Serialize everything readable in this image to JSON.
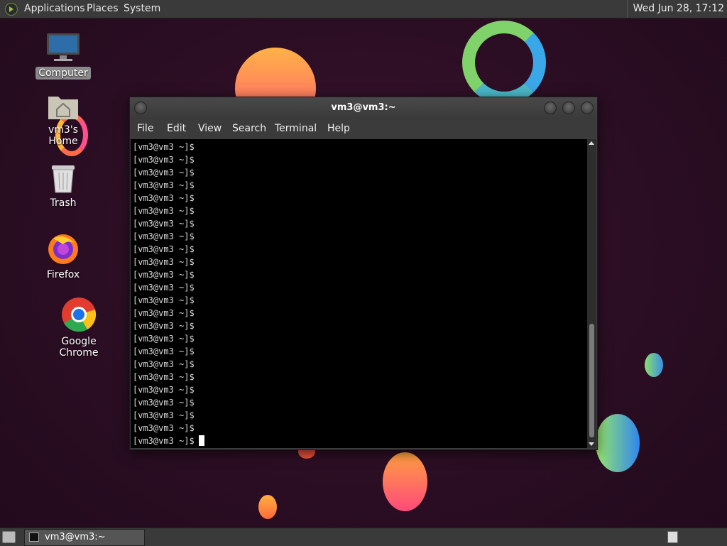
{
  "top_panel": {
    "menus": [
      "Applications",
      "Places",
      "System"
    ],
    "clock": "Wed Jun 28, 17:12"
  },
  "desktop_icons": [
    {
      "label": "Computer",
      "icon": "computer-icon"
    },
    {
      "label": "vm3's Home",
      "icon": "home-folder-icon"
    },
    {
      "label": "Trash",
      "icon": "trash-icon"
    },
    {
      "label": "Firefox",
      "icon": "firefox-icon"
    },
    {
      "label": "Google Chrome",
      "icon": "chrome-icon"
    }
  ],
  "terminal": {
    "title": "vm3@vm3:~",
    "menu": [
      "File",
      "Edit",
      "View",
      "Search",
      "Terminal",
      "Help"
    ],
    "prompt": "[vm3@vm3 ~]$",
    "line_count": 24
  },
  "taskbar": {
    "items": [
      {
        "label": "vm3@vm3:~"
      }
    ]
  },
  "colors": {
    "panel": "#3a3a3a",
    "terminal_bg": "#000000",
    "desktop_bg": "#2a0d22"
  }
}
